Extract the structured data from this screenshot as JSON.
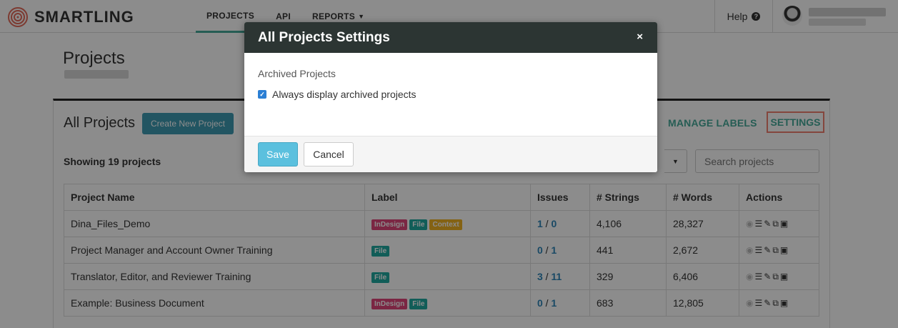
{
  "brand": {
    "name": "SMARTLING"
  },
  "nav": {
    "items": [
      {
        "label": "PROJECTS",
        "active": true
      },
      {
        "label": "API",
        "active": false
      },
      {
        "label": "REPORTS",
        "active": false
      }
    ],
    "help_label": "Help"
  },
  "page": {
    "title": "Projects"
  },
  "panel": {
    "title": "All Projects",
    "create_label": "Create New Project",
    "manage_labels": "MANAGE LABELS",
    "settings": "SETTINGS",
    "showing": "Showing 19 projects",
    "search_placeholder": "Search projects"
  },
  "table": {
    "headers": [
      "Project Name",
      "Label",
      "Issues",
      "# Strings",
      "# Words",
      "Actions"
    ],
    "rows": [
      {
        "name": "Dina_Files_Demo",
        "issues_a": "1",
        "issues_b": "0",
        "strings": "4,106",
        "words": "28,327"
      },
      {
        "name": "Project Manager and Account Owner Training",
        "issues_a": "0",
        "issues_b": "1",
        "strings": "441",
        "words": "2,672"
      },
      {
        "name": "Translator, Editor, and Reviewer Training",
        "issues_a": "3",
        "issues_b": "11",
        "strings": "329",
        "words": "6,406"
      },
      {
        "name": "Example: Business Document",
        "issues_a": "0",
        "issues_b": "1",
        "strings": "683",
        "words": "12,805"
      }
    ],
    "tags": {
      "indesign": "InDesign",
      "file": "File",
      "context": "Context"
    },
    "colors": {
      "indesign": "#e0457b",
      "file": "#1fa9a0",
      "context": "#f0b323"
    }
  },
  "modal": {
    "title": "All Projects Settings",
    "close_icon": "×",
    "section_label": "Archived Projects",
    "checkbox_label": "Always display archived projects",
    "checkbox_checked": true,
    "save_label": "Save",
    "cancel_label": "Cancel"
  }
}
